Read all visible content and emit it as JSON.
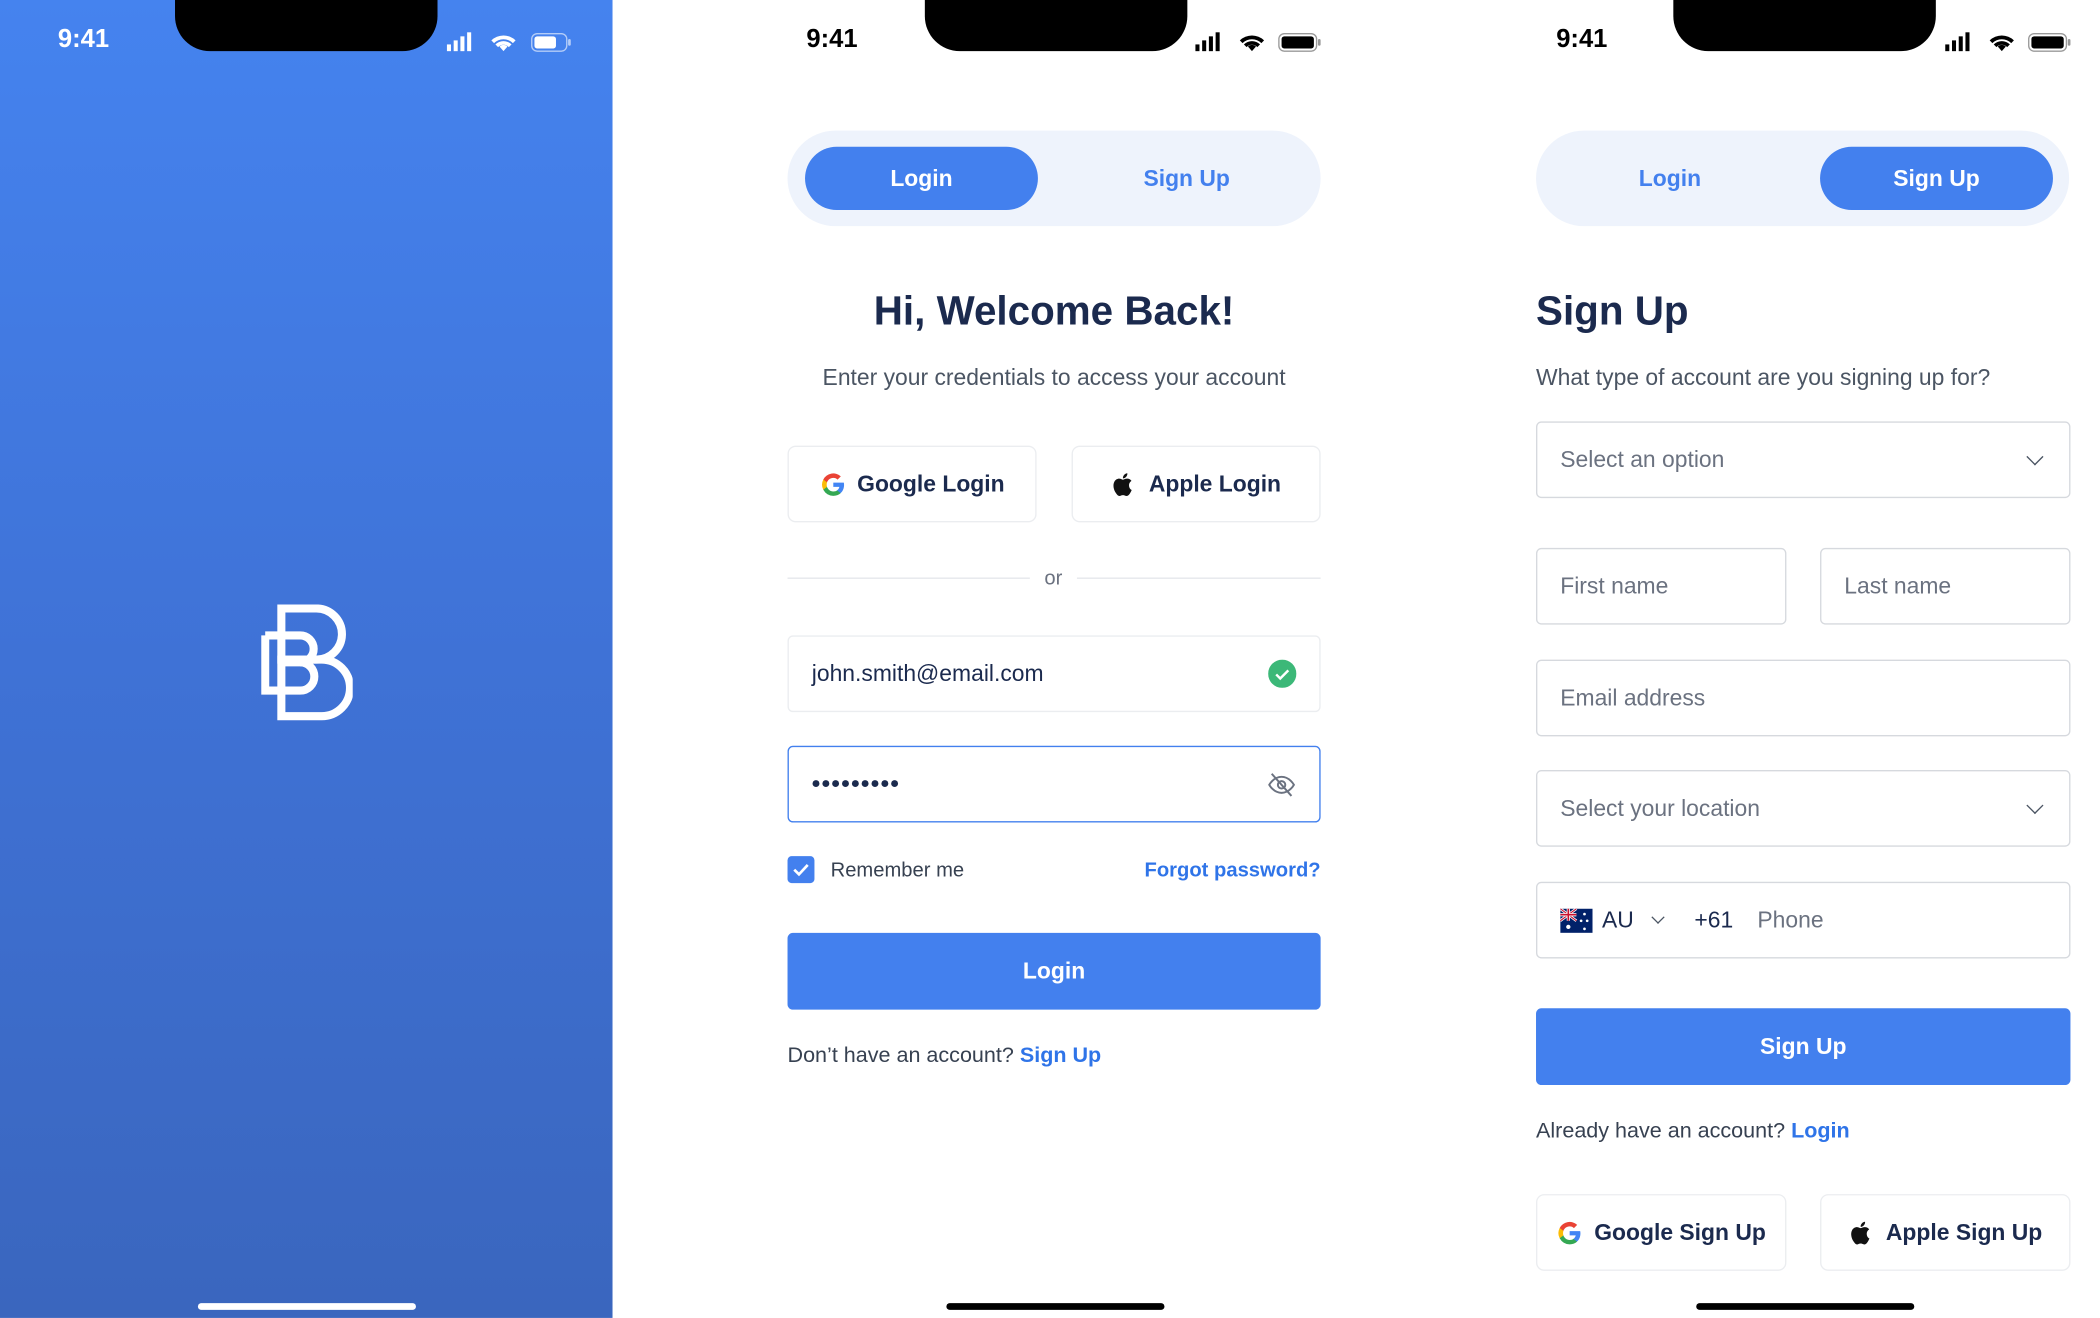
{
  "status_bar": {
    "time": "9:41"
  },
  "splash": {
    "logo": "B-logo",
    "background_colors": [
      "#4583EF",
      "#3A66BE"
    ]
  },
  "login": {
    "tabs": [
      {
        "label": "Login",
        "active": true
      },
      {
        "label": "Sign Up",
        "active": false
      }
    ],
    "title": "Hi, Welcome Back!",
    "subtitle": "Enter your credentials to access your account",
    "google_button": "Google Login",
    "apple_button": "Apple Login",
    "divider": "or",
    "email_value": "john.smith@email.com",
    "password_value": "•••••••••",
    "remember_label": "Remember me",
    "remember_checked": true,
    "forgot_link": "Forgot password?",
    "submit": "Login",
    "footer_text": "Don’t have an account?",
    "footer_link": "Sign Up"
  },
  "signup": {
    "tabs": [
      {
        "label": "Login",
        "active": false
      },
      {
        "label": "Sign Up",
        "active": true
      }
    ],
    "title": "Sign Up",
    "subtitle": "What type of account are you signing up for?",
    "account_type_placeholder": "Select an option",
    "first_name_placeholder": "First name",
    "last_name_placeholder": "Last name",
    "email_placeholder": "Email address",
    "location_placeholder": "Select your location",
    "country_code": "AU",
    "dial_code": "+61",
    "phone_placeholder": "Phone",
    "submit": "Sign Up",
    "footer_text": "Already have an account?",
    "footer_link": "Login",
    "google_button": "Google Sign Up",
    "apple_button": "Apple Sign Up"
  },
  "colors": {
    "accent": "#4380EE",
    "heading": "#1B2A4E",
    "success": "#3CB878",
    "tab_bg": "#EEF3FC"
  }
}
